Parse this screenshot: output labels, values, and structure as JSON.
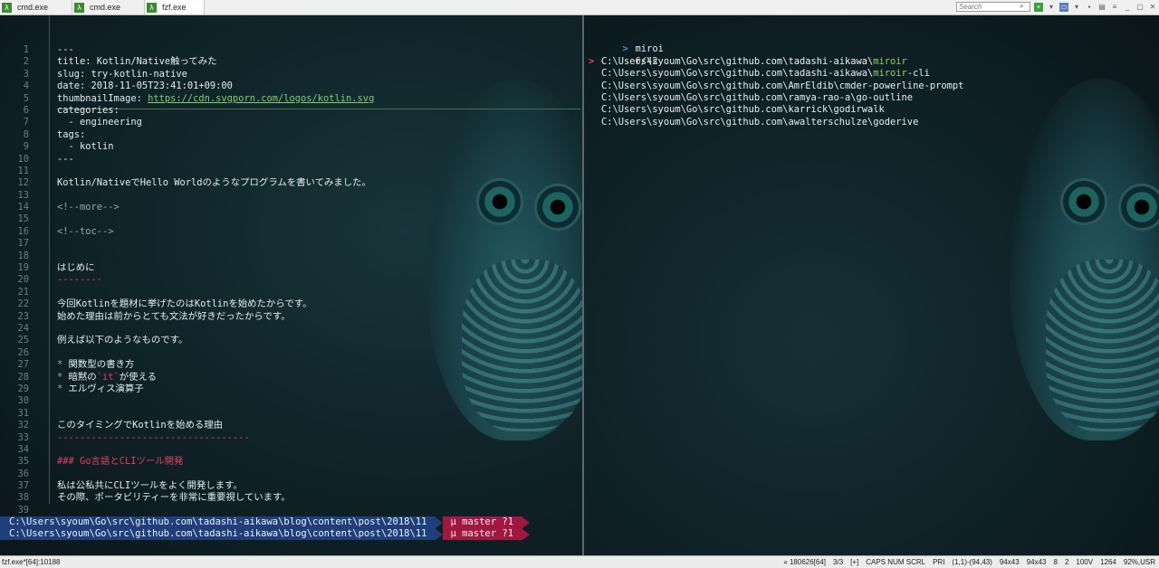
{
  "tabs": [
    {
      "label": "cmd.exe",
      "active": false
    },
    {
      "label": "cmd.exe",
      "active": false
    },
    {
      "label": "fzf.exe",
      "active": true
    }
  ],
  "tab_icon_glyph": "λ",
  "search": {
    "placeholder": "Search"
  },
  "editor": {
    "lines": [
      {
        "n": "1",
        "text": "---"
      },
      {
        "n": "2",
        "text": "title: Kotlin/Native触ってみた"
      },
      {
        "n": "3",
        "text": "slug: try-kotlin-native"
      },
      {
        "n": "4",
        "text": "date: 2018-11-05T23:41:01+09:00"
      },
      {
        "n": "5",
        "text": "thumbnailImage: ",
        "url": "https://cdn.svgporn.com/logos/kotlin.svg"
      },
      {
        "n": "6",
        "text": "categories:"
      },
      {
        "n": "7",
        "text": "  - engineering"
      },
      {
        "n": "8",
        "text": "tags:"
      },
      {
        "n": "9",
        "text": "  - kotlin"
      },
      {
        "n": "10",
        "text": "---"
      },
      {
        "n": "11",
        "text": ""
      },
      {
        "n": "12",
        "text": "Kotlin/NativeでHello Worldのようなプログラムを書いてみました。"
      },
      {
        "n": "13",
        "text": ""
      },
      {
        "n": "14",
        "text": "<!--more-->",
        "dim": true
      },
      {
        "n": "15",
        "text": ""
      },
      {
        "n": "16",
        "text": "<!--toc-->",
        "dim": true
      },
      {
        "n": "17",
        "text": ""
      },
      {
        "n": "18",
        "text": ""
      },
      {
        "n": "19",
        "text": "はじめに"
      },
      {
        "n": "20",
        "text": "--------",
        "red": true
      },
      {
        "n": "21",
        "text": ""
      },
      {
        "n": "22",
        "text": "今回Kotlinを題材に挙げたのはKotlinを始めたからです。"
      },
      {
        "n": "23",
        "text": "始めた理由は前からとても文法が好きだったからです。"
      },
      {
        "n": "24",
        "text": ""
      },
      {
        "n": "25",
        "text": "例えば以下のようなものです。"
      },
      {
        "n": "26",
        "text": ""
      },
      {
        "n": "27",
        "text": "関数型の書き方",
        "bullet": "*"
      },
      {
        "n": "28",
        "text": "暗黙の",
        "bullet": "*",
        "code": "`it`",
        "after": "が使える"
      },
      {
        "n": "29",
        "text": "エルヴィス演算子",
        "bullet": "*"
      },
      {
        "n": "30",
        "text": ""
      },
      {
        "n": "31",
        "text": ""
      },
      {
        "n": "32",
        "text": "このタイミングでKotlinを始める理由"
      },
      {
        "n": "33",
        "text": "----------------------------------",
        "red": true
      },
      {
        "n": "34",
        "text": ""
      },
      {
        "n": "35",
        "text": "### Go言語とCLIツール開発",
        "red": true
      },
      {
        "n": "36",
        "text": ""
      },
      {
        "n": "37",
        "text": "私は公私共にCLIツールをよく開発します。"
      },
      {
        "n": "38",
        "text": "その際、ポータビリティーを非常に重要視しています。"
      },
      {
        "n": "39",
        "text": ""
      }
    ]
  },
  "prompts": [
    {
      "path": "C:\\Users\\syoum\\Go\\src\\github.com\\tadashi-aikawa\\blog\\content\\post\\2018\\11",
      "branch": "μ master ?1"
    },
    {
      "path": "C:\\Users\\syoum\\Go\\src\\github.com\\tadashi-aikawa\\blog\\content\\post\\2018\\11",
      "branch": "μ master ?1"
    }
  ],
  "fzf": {
    "prompt_symbol": ">",
    "query": "miroi",
    "count": "6/42",
    "pointer": ">",
    "results": [
      {
        "pre": "C:\\Users\\syoum\\Go\\src\\github.com\\tadashi-aikawa\\",
        "m": "miroir",
        "post": "",
        "selected": true
      },
      {
        "pre": "C:\\Users\\syoum\\Go\\src\\github.com\\tadashi-aikawa\\",
        "m": "miroir",
        "post": "-cli",
        "selected": false
      },
      {
        "pre": "C:\\Users\\syoum\\Go\\src\\github.com\\AmrEldib\\cmder-powerline-prompt",
        "m": "",
        "post": "",
        "selected": false
      },
      {
        "pre": "C:\\Users\\syoum\\Go\\src\\github.com\\ramya-rao-a\\go-outline",
        "m": "",
        "post": "",
        "selected": false
      },
      {
        "pre": "C:\\Users\\syoum\\Go\\src\\github.com\\karrick\\godirwalk",
        "m": "",
        "post": "",
        "selected": false
      },
      {
        "pre": "C:\\Users\\syoum\\Go\\src\\github.com\\awalterschulze\\goderive",
        "m": "",
        "post": "",
        "selected": false
      }
    ]
  },
  "status": {
    "left": "fzf.exe*[64]:10188",
    "segments": [
      "« 180626[64]",
      "3/3",
      "[+]",
      "CAPS NUM SCRL",
      "PRI",
      "(1,1)-(94,43)",
      "94x43",
      "94x43",
      "8",
      "2",
      "100V",
      "1264",
      "92%,USR"
    ]
  },
  "colors": {
    "accent_green": "#3c8a2e",
    "prompt_blue": "#1f3f7a",
    "branch_red": "#a01840",
    "fzf_match": "#8fd05a"
  }
}
